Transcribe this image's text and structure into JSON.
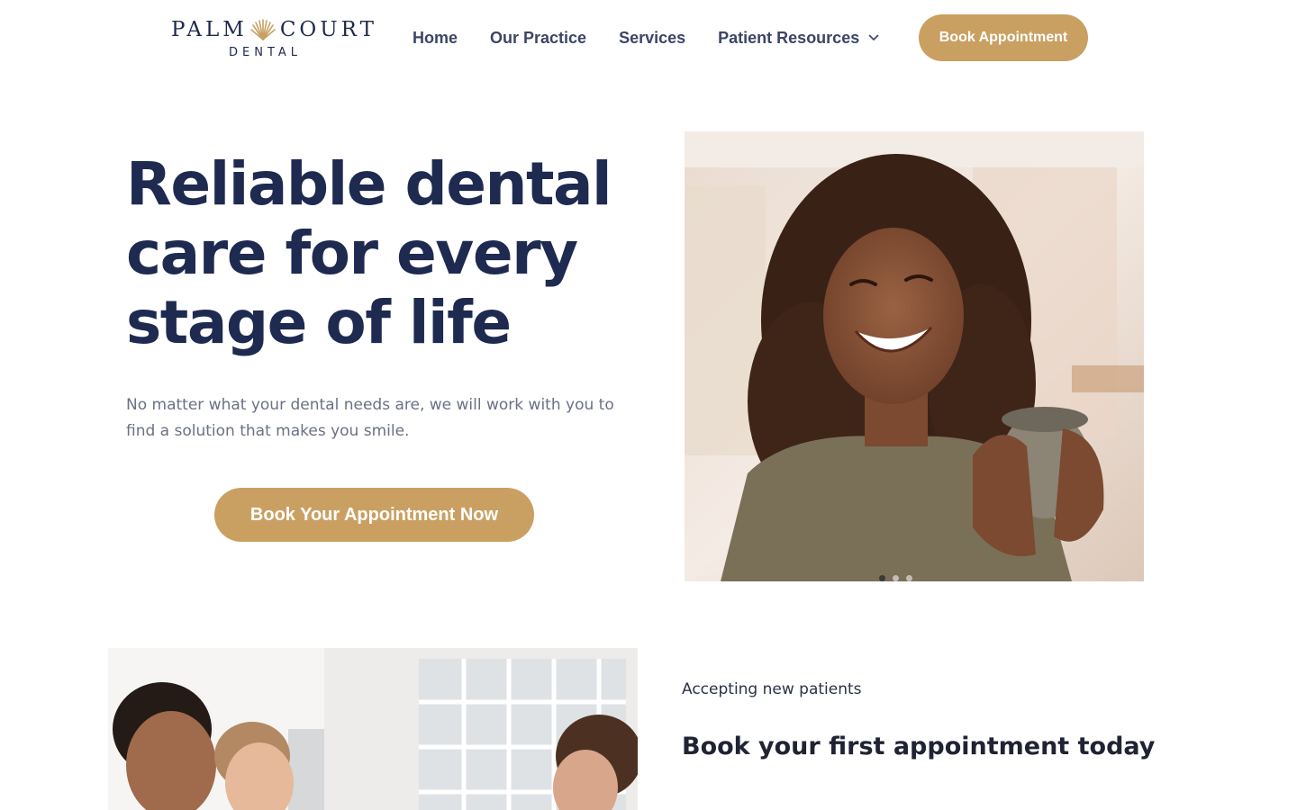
{
  "brand": {
    "name_left": "PALM",
    "name_right": "COURT",
    "name_sub": "DENTAL",
    "logo_icon": "palm-leaf-icon",
    "accent_color": "#c9a062",
    "navy_color": "#1e2a4f"
  },
  "nav": {
    "items": [
      {
        "label": "Home"
      },
      {
        "label": "Our Practice"
      },
      {
        "label": "Services"
      },
      {
        "label": "Patient Resources",
        "icon": "chevron-down-icon"
      }
    ],
    "cta_label": "Book Appointment"
  },
  "hero": {
    "title_lines": [
      "Reliable dental",
      "care for every",
      "stage of life"
    ],
    "subtitle": "No matter what your dental needs are, we will work with you to find a solution that makes you smile.",
    "cta_label": "Book Your Appointment Now",
    "image": "smiling-woman-holding-mug-photo",
    "slides_count": 3,
    "active_slide": 1
  },
  "booking_section": {
    "eyebrow": "Accepting new patients",
    "heading_prefix": "Book your first appointment ",
    "heading_bold": "today",
    "image": "dental-team-photo"
  }
}
